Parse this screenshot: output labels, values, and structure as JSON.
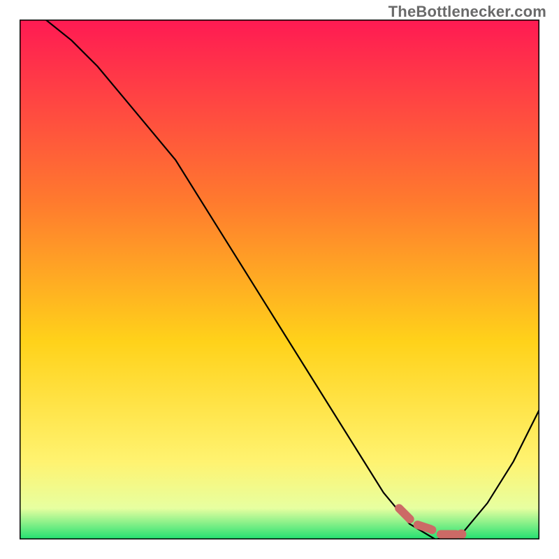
{
  "watermark": {
    "text": "TheBottlenecker.com"
  },
  "colors": {
    "gradient_top": "#ff1a53",
    "gradient_mid_upper": "#ff7a2e",
    "gradient_mid": "#ffd21a",
    "gradient_mid_lower": "#fff370",
    "gradient_band": "#e7ffa0",
    "gradient_bottom": "#20e070",
    "curve_stroke": "#000000",
    "marker_stroke": "#cc6a66",
    "marker_fill": "#cc6a66",
    "frame": "#000000"
  },
  "chart_data": {
    "type": "line",
    "title": "",
    "xlabel": "",
    "ylabel": "",
    "xlim": [
      0,
      100
    ],
    "ylim": [
      0,
      100
    ],
    "grid": false,
    "legend": false,
    "axes_visible": false,
    "series": [
      {
        "name": "bottleneck-curve",
        "x": [
          5,
          10,
          15,
          20,
          25,
          30,
          35,
          40,
          45,
          50,
          55,
          60,
          65,
          70,
          75,
          80,
          85,
          90,
          95,
          100
        ],
        "values": [
          100,
          96,
          91,
          85,
          79,
          73,
          65,
          57,
          49,
          41,
          33,
          25,
          17,
          9,
          3,
          0,
          1,
          7,
          15,
          25
        ]
      }
    ],
    "markers": {
      "name": "highlight-points",
      "x": [
        73,
        76,
        79,
        81,
        83,
        85
      ],
      "values": [
        6,
        3,
        2,
        1,
        1,
        1
      ]
    }
  }
}
